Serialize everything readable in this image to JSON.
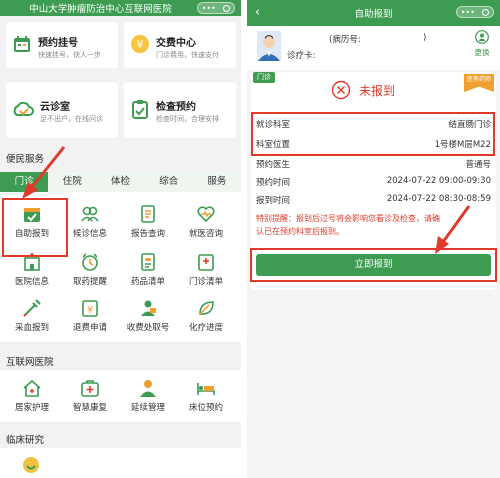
{
  "left": {
    "title": "中山大学肿瘤防治中心互联网医院",
    "services": [
      {
        "title": "预约挂号",
        "sub": "快速挂号，快人一步"
      },
      {
        "title": "交费中心",
        "sub": "门诊费用，快速支付"
      },
      {
        "title": "云诊室",
        "sub": "足不出户，在线问诊"
      },
      {
        "title": "检查预约",
        "sub": "检查时间，合理安排"
      }
    ],
    "services_coin": "¥",
    "convenience_title": "便民服务",
    "tabs": [
      "门诊",
      "住院",
      "体检",
      "综合",
      "服务"
    ],
    "grid": [
      {
        "label": "自助报到"
      },
      {
        "label": "候诊信息"
      },
      {
        "label": "报告查询"
      },
      {
        "label": "就医咨询"
      },
      {
        "label": "医院信息"
      },
      {
        "label": "取药提醒"
      },
      {
        "label": "药品清单"
      },
      {
        "label": "门诊清单"
      },
      {
        "label": "采血报到"
      },
      {
        "label": "退费申请"
      },
      {
        "label": "收费处取号"
      },
      {
        "label": "化疗进度"
      }
    ],
    "internet_title": "互联网医院",
    "internet_items": [
      {
        "label": "居家护理"
      },
      {
        "label": "智慧康复"
      },
      {
        "label": "延续管理"
      },
      {
        "label": "床位预约"
      }
    ],
    "research_title": "临床研究"
  },
  "right": {
    "title": "自助报到",
    "record_label": "(病历号:",
    "record_value": "",
    "record_end": ")",
    "card_label": "诊疗卡:",
    "switch_label": "更换",
    "badge": "门诊",
    "corner_tag": "医务药师",
    "status": "未报到",
    "info": [
      {
        "k": "就诊科室",
        "v": "结直肠门诊"
      },
      {
        "k": "科室位置",
        "v": "1号楼M层M22"
      },
      {
        "k": "预约医生",
        "v": "普通号"
      },
      {
        "k": "预约时间",
        "v": "2024-07-22 09:00-09:30"
      },
      {
        "k": "报到时间",
        "v": "2024-07-22 08:30-08:59"
      }
    ],
    "notice_prefix": "特别提醒：",
    "notice_line1": "报到后过号将会影响您看诊及检查，请确",
    "notice_line2": "认已在预约科室后报到。",
    "button": "立即报到"
  },
  "colors": {
    "green": "#3e9b52",
    "red": "#e23a2a",
    "orange": "#f0a030"
  }
}
